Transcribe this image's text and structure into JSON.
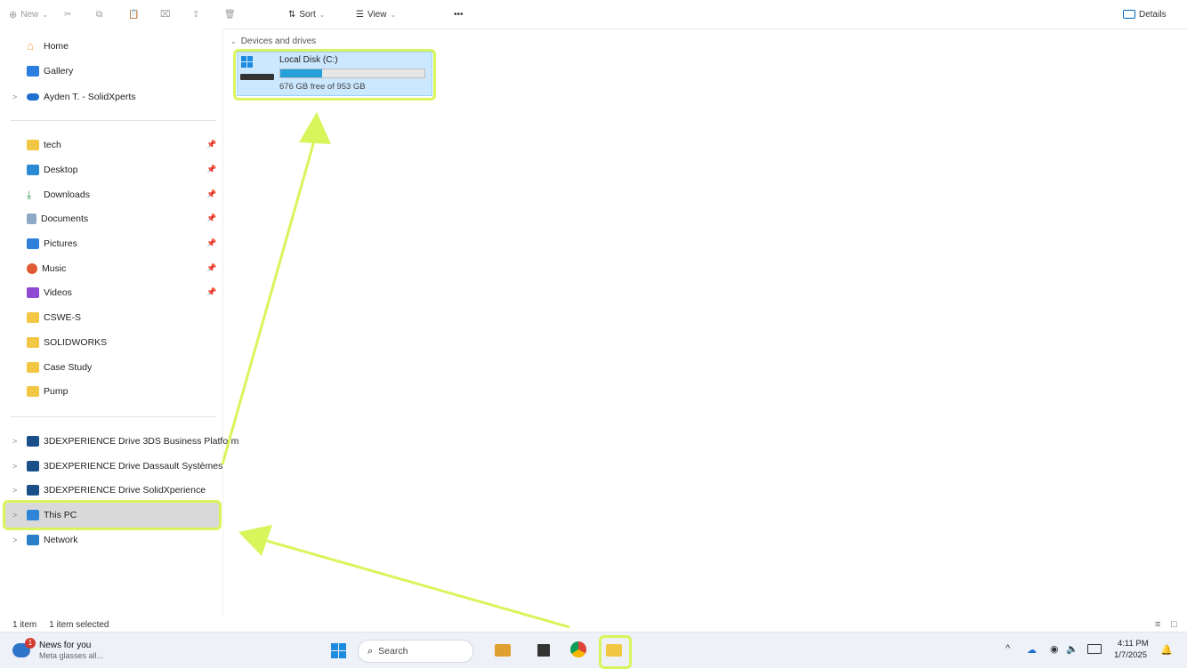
{
  "toolbar": {
    "new_label": "New",
    "sort_label": "Sort",
    "view_label": "View",
    "more_label": "•••",
    "details_label": "Details"
  },
  "sidebar": {
    "top_items": [
      {
        "label": "Home",
        "icon": "home-icon"
      },
      {
        "label": "Gallery",
        "icon": "gallery-icon"
      },
      {
        "label": "Ayden T. - SolidXperts",
        "icon": "onedrive-cloud-icon"
      }
    ],
    "pinned_items": [
      {
        "label": "tech",
        "icon": "folder-icon",
        "pinned": true
      },
      {
        "label": "Desktop",
        "icon": "desktop-icon",
        "pinned": true
      },
      {
        "label": "Downloads",
        "icon": "download-icon",
        "pinned": true
      },
      {
        "label": "Documents",
        "icon": "documents-icon",
        "pinned": true
      },
      {
        "label": "Pictures",
        "icon": "pictures-icon",
        "pinned": true
      },
      {
        "label": "Music",
        "icon": "music-icon",
        "pinned": true
      },
      {
        "label": "Videos",
        "icon": "videos-icon",
        "pinned": true
      },
      {
        "label": "CSWE-S",
        "icon": "folder-icon",
        "pinned": false
      },
      {
        "label": "SOLIDWORKS",
        "icon": "folder-icon",
        "pinned": false
      },
      {
        "label": "Case Study",
        "icon": "folder-icon",
        "pinned": false
      },
      {
        "label": "Pump",
        "icon": "folder-icon",
        "pinned": false
      }
    ],
    "drive_items": [
      {
        "label": "3DEXPERIENCE Drive 3DS Business Platform",
        "icon": "3dexperience-icon"
      },
      {
        "label": "3DEXPERIENCE Drive Dassault Systèmes",
        "icon": "3dexperience-icon"
      },
      {
        "label": "3DEXPERIENCE Drive SolidXperience",
        "icon": "3dexperience-icon"
      },
      {
        "label": "This PC",
        "icon": "pc-icon",
        "selected": true
      },
      {
        "label": "Network",
        "icon": "network-icon"
      }
    ]
  },
  "main": {
    "group_label": "Devices and drives",
    "drive": {
      "name": "Local Disk (C:)",
      "free_text": "676 GB free of 953 GB",
      "used_fraction": 0.29
    }
  },
  "status": {
    "count": "1 item",
    "selected": "1 item selected"
  },
  "taskbar": {
    "news_title": "News for you",
    "news_sub": "Meta glasses all...",
    "news_badge": "1",
    "search_placeholder": "Search",
    "time": "4:11 PM",
    "date": "1/7/2025"
  },
  "colors": {
    "accent": "#0067c0",
    "highlight": "#d8f55b",
    "selection": "#cce8ff",
    "folder": "#f2c744"
  }
}
